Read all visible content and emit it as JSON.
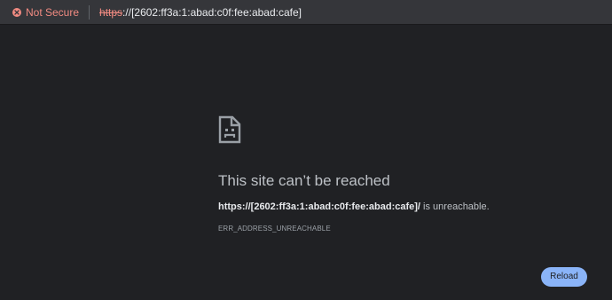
{
  "address_bar": {
    "security_label": "Not Secure",
    "url_scheme": "https",
    "url_separator": "://",
    "url_host": "[2602:ff3a:1:abad:c0f:fee:abad:cafe]",
    "icon": "warning-x-icon",
    "warning_color": "#f28b82"
  },
  "error": {
    "icon": "sad-document-icon",
    "title": "This site can’t be reached",
    "url": "https://[2602:ff3a:1:abad:c0f:fee:abad:cafe]/",
    "message_suffix": " is unreachable.",
    "code": "ERR_ADDRESS_UNREACHABLE",
    "reload_label": "Reload",
    "accent_color": "#8ab4f8"
  }
}
